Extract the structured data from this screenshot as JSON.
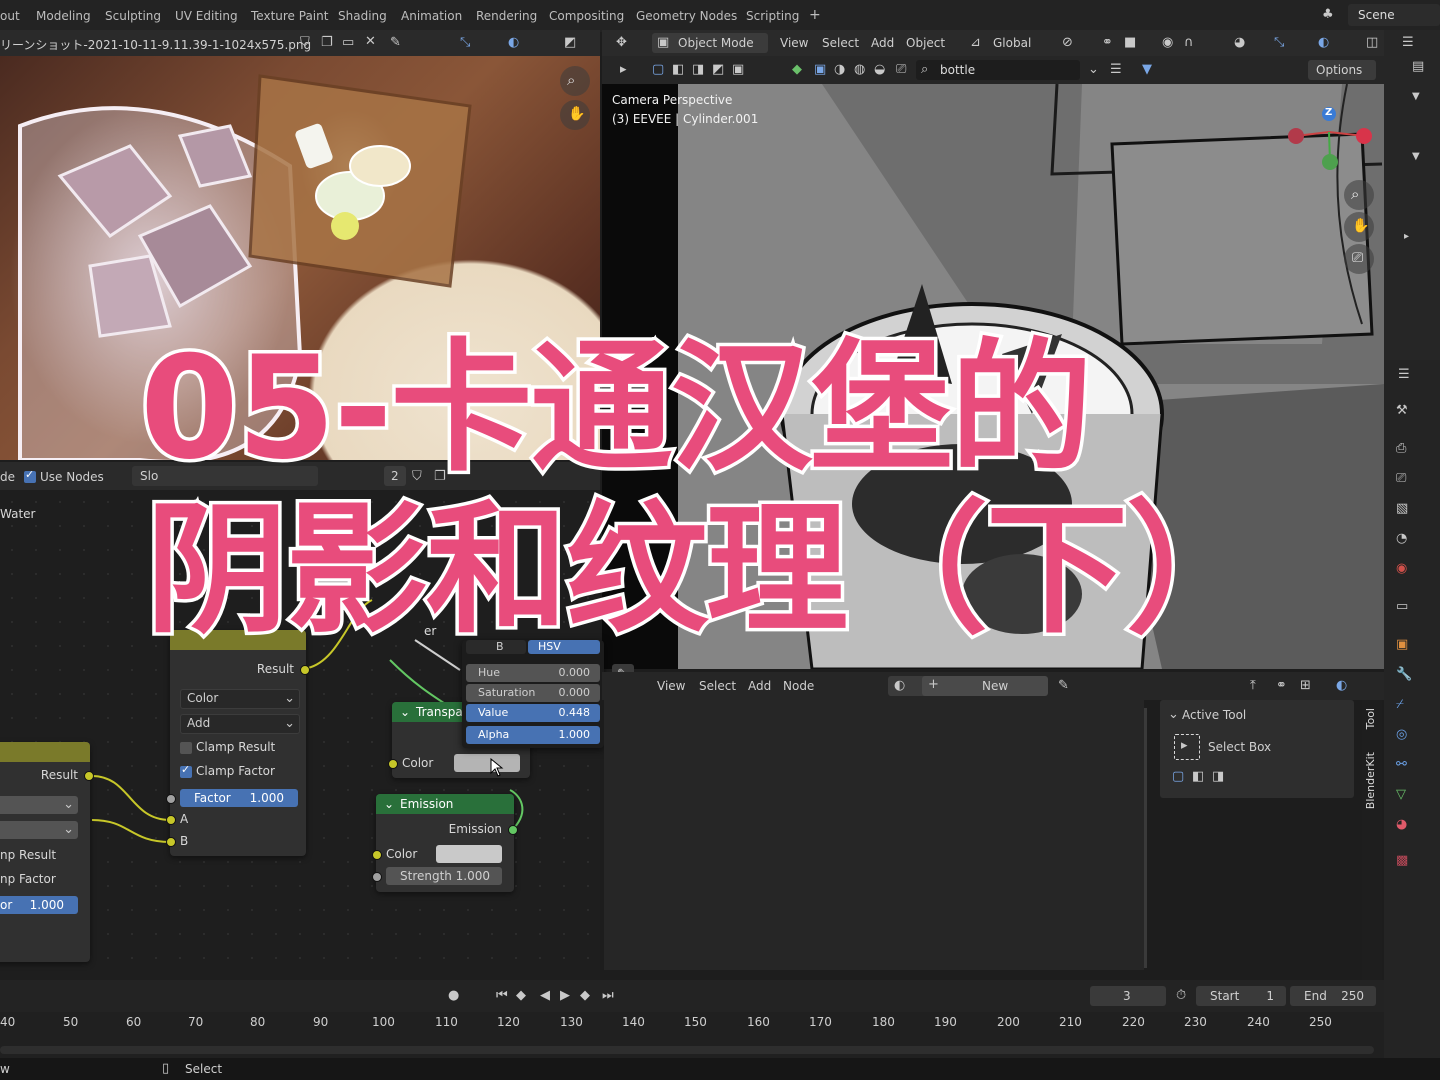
{
  "topbar": {
    "workspaces": [
      "out",
      "Modeling",
      "Sculpting",
      "UV Editing",
      "Texture Paint",
      "Shading",
      "Animation",
      "Rendering",
      "Compositing",
      "Geometry Nodes",
      "Scripting"
    ],
    "add_tab": "+",
    "scene_label": "Scene"
  },
  "image_editor": {
    "filename": "リーンショット-2021-10-11-9.11.39-1-1024x575.png"
  },
  "viewport": {
    "mode": "Object Mode",
    "menu": [
      "View",
      "Select",
      "Add",
      "Object"
    ],
    "transform_orientation": "Global",
    "search_value": "bottle",
    "options_label": "Options",
    "overlay_line1": "Camera Perspective",
    "overlay_line2": "(3) EEVEE | Cylinder.001",
    "gizmo_axis": "Z"
  },
  "node_editor": {
    "header_left": "de",
    "use_nodes_label": "Use Nodes",
    "slot_label": "Slo",
    "user_count": "2",
    "material_name": "Water",
    "left_node": {
      "result": "Result",
      "clamp_result": "np Result",
      "clamp_factor": "np Factor",
      "factor_label": "or",
      "factor_value": "1.000"
    },
    "mix_node": {
      "result": "Result",
      "blend_type": "Color",
      "operation": "Add",
      "clamp_result": "Clamp Result",
      "clamp_factor": "Clamp Factor",
      "factor_label": "Factor",
      "factor_value": "1.000",
      "in_a": "A",
      "in_b": "B"
    },
    "transparent_node": {
      "title": "Transpa",
      "color_label": "Color"
    },
    "emission_node": {
      "title": "Emission",
      "out": "Emission",
      "color_label": "Color",
      "strength_label": "Strength",
      "strength_value": "1.000"
    },
    "color_picker": {
      "tab_rgb": "B",
      "tab_hsv": "HSV",
      "hue_label": "Hue",
      "hue_value": "0.000",
      "sat_label": "Saturation",
      "sat_value": "0.000",
      "val_label": "Value",
      "val_value": "0.448",
      "alpha_label": "Alpha",
      "alpha_value": "1.000"
    },
    "partial_er": "er"
  },
  "shader_header": {
    "menu": [
      "View",
      "Select",
      "Add",
      "Node"
    ],
    "new_label": "New"
  },
  "tool_panel": {
    "section": "Active Tool",
    "tool_name": "Select Box",
    "tab_tool": "Tool",
    "tab_blenderkit": "BlenderKit"
  },
  "timeline": {
    "current_frame": "3",
    "start_label": "Start",
    "start_value": "1",
    "end_label": "End",
    "end_value": "250",
    "ruler": [
      "40",
      "50",
      "60",
      "70",
      "80",
      "90",
      "100",
      "110",
      "120",
      "130",
      "140",
      "150",
      "160",
      "170",
      "180",
      "190",
      "200",
      "210",
      "220",
      "230",
      "240",
      "250"
    ]
  },
  "status": {
    "left": "w",
    "select_label": "Select"
  },
  "overlay_title": {
    "line1": "05-卡通汉堡的",
    "line2": "阴影和纹理（下）"
  },
  "colors": {
    "title_fill": "#e84c7c",
    "title_stroke": "#ffffff",
    "blender_blue": "#4772b3",
    "emission_header": "#29703a",
    "mix_header": "#7a7a2a",
    "socket_yellow": "#c7c729"
  }
}
